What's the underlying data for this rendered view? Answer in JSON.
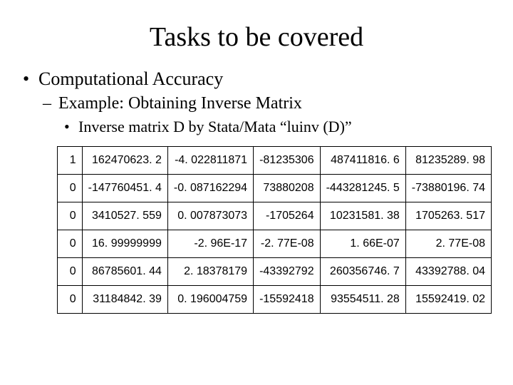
{
  "title": "Tasks to be covered",
  "bullets": {
    "level1": "Computational Accuracy",
    "level2": "Example: Obtaining Inverse Matrix",
    "level3": "Inverse matrix D by Stata/Mata “luinv (D)”"
  },
  "table": {
    "rows": [
      [
        "1",
        "162470623. 2",
        "-4. 022811871",
        "-81235306",
        "487411816. 6",
        "81235289. 98"
      ],
      [
        "0",
        "-147760451. 4",
        "-0. 087162294",
        "73880208",
        "-443281245. 5",
        "-73880196. 74"
      ],
      [
        "0",
        "3410527. 559",
        "0. 007873073",
        "-1705264",
        "10231581. 38",
        "1705263. 517"
      ],
      [
        "0",
        "16. 99999999",
        "-2. 96E-17",
        "-2. 77E-08",
        "1. 66E-07",
        "2. 77E-08"
      ],
      [
        "0",
        "86785601. 44",
        "2. 18378179",
        "-43392792",
        "260356746. 7",
        "43392788. 04"
      ],
      [
        "0",
        "31184842. 39",
        "0. 196004759",
        "-15592418",
        "93554511. 28",
        "15592419. 02"
      ]
    ]
  }
}
